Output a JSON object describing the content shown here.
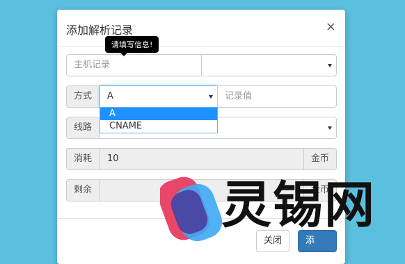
{
  "dialog": {
    "title": "添加解析记录",
    "close_icon": "×",
    "tooltip": "请填写信息!"
  },
  "form": {
    "host": {
      "placeholder": "主机记录"
    },
    "mode": {
      "label": "方式",
      "value": "A",
      "options": [
        "A",
        "CNAME"
      ],
      "highlighted": "A"
    },
    "record_value": {
      "placeholder": "记录值"
    },
    "line": {
      "label": "线路"
    },
    "cost": {
      "label": "消耗",
      "value": "10",
      "unit": "金币"
    },
    "remaining": {
      "label": "剩余",
      "unit": "金币"
    }
  },
  "footer": {
    "close_label": "关闭",
    "add_label": "添"
  },
  "watermark": {
    "text": "灵锡网"
  },
  "colors": {
    "background": "#5bc0de",
    "primary": "#337ab7",
    "highlight": "#1e90ff"
  }
}
